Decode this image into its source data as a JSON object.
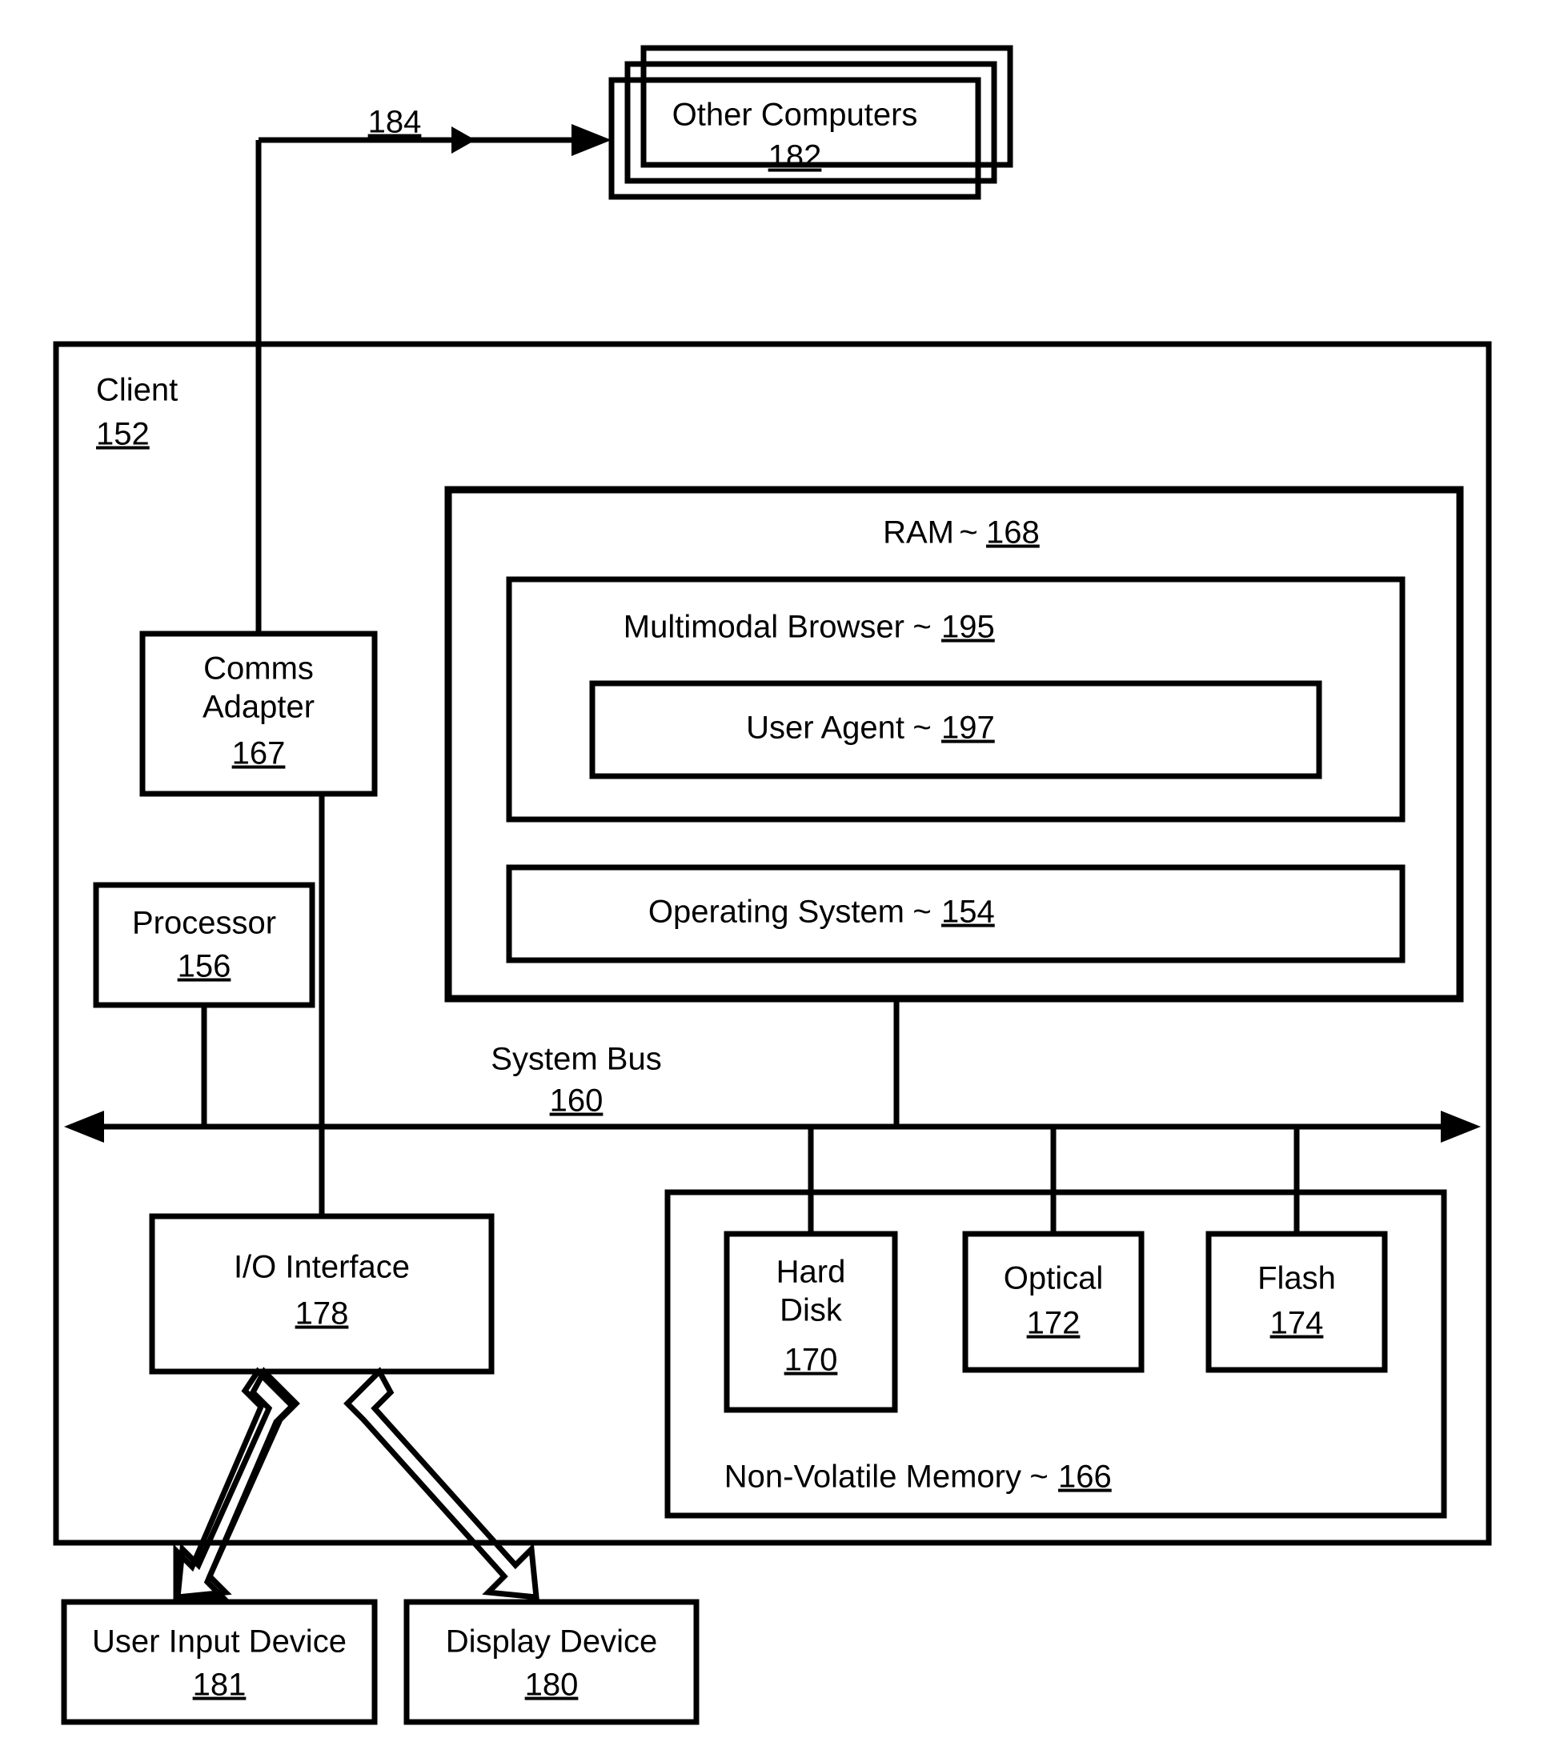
{
  "other_computers": {
    "label": "Other Computers",
    "ref": "182"
  },
  "link_ref": "184",
  "client": {
    "label": "Client",
    "ref": "152"
  },
  "comms_adapter": {
    "label_line1": "Comms",
    "label_line2": "Adapter",
    "ref": "167"
  },
  "processor": {
    "label": "Processor",
    "ref": "156"
  },
  "ram": {
    "label": "RAM",
    "ref": "168"
  },
  "multimodal_browser": {
    "label": "Multimodal Browser",
    "ref": "195"
  },
  "user_agent": {
    "label": "User Agent",
    "ref": "197"
  },
  "operating_system": {
    "label": "Operating System",
    "ref": "154"
  },
  "system_bus": {
    "label": "System Bus",
    "ref": "160"
  },
  "io": {
    "label": "I/O Interface",
    "ref": "178"
  },
  "hard_disk": {
    "label_line1": "Hard",
    "label_line2": "Disk",
    "ref": "170"
  },
  "optical": {
    "label": "Optical",
    "ref": "172"
  },
  "flash": {
    "label": "Flash",
    "ref": "174"
  },
  "nvm": {
    "label": "Non-Volatile Memory",
    "ref": "166"
  },
  "user_input": {
    "label": "User Input Device",
    "ref": "181"
  },
  "display": {
    "label": "Display Device",
    "ref": "180"
  },
  "tilde": "~"
}
